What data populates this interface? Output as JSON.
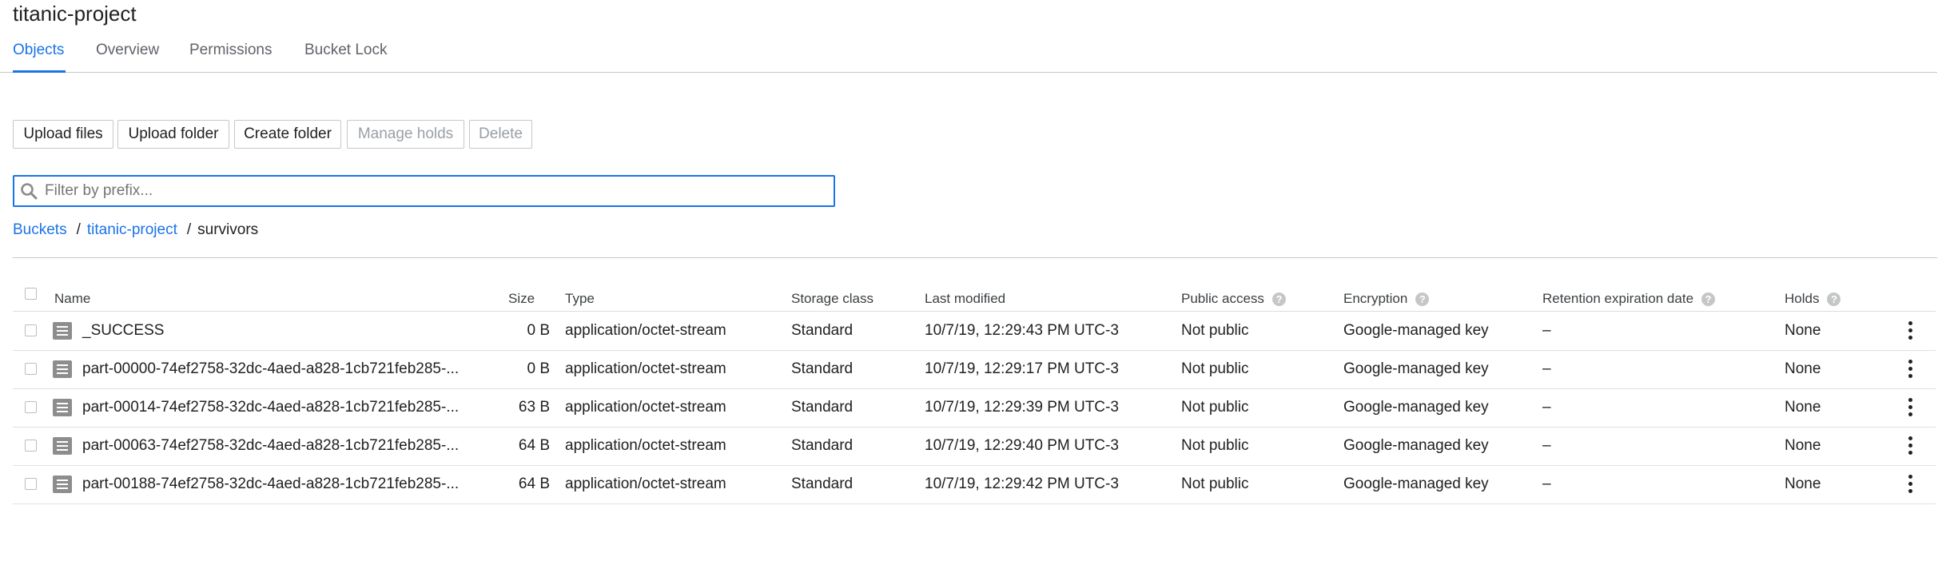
{
  "page": {
    "title": "titanic-project"
  },
  "tabs": [
    {
      "label": "Objects",
      "active": true
    },
    {
      "label": "Overview"
    },
    {
      "label": "Permissions"
    },
    {
      "label": "Bucket Lock"
    }
  ],
  "toolbar": {
    "upload_files": "Upload files",
    "upload_folder": "Upload folder",
    "create_folder": "Create folder",
    "manage_holds": "Manage holds",
    "delete": "Delete"
  },
  "filter": {
    "placeholder": "Filter by prefix...",
    "value": "",
    "icon": "search-icon"
  },
  "breadcrumb": {
    "root": "Buckets",
    "bucket": "titanic-project",
    "current": "survivors",
    "separator": "/"
  },
  "table": {
    "columns": {
      "name": "Name",
      "size": "Size",
      "type": "Type",
      "storage_class": "Storage class",
      "last_modified": "Last modified",
      "public_access": "Public access",
      "encryption": "Encryption",
      "retention": "Retention expiration date",
      "holds": "Holds"
    },
    "help_icon": "?",
    "rows": [
      {
        "name": "_SUCCESS",
        "size": "0 B",
        "type": "application/octet-stream",
        "storage_class": "Standard",
        "last_modified": "10/7/19, 12:29:43 PM UTC-3",
        "public_access": "Not public",
        "encryption": "Google-managed key",
        "retention": "–",
        "holds": "None"
      },
      {
        "name": "part-00000-74ef2758-32dc-4aed-a828-1cb721feb285-...",
        "size": "0 B",
        "type": "application/octet-stream",
        "storage_class": "Standard",
        "last_modified": "10/7/19, 12:29:17 PM UTC-3",
        "public_access": "Not public",
        "encryption": "Google-managed key",
        "retention": "–",
        "holds": "None"
      },
      {
        "name": "part-00014-74ef2758-32dc-4aed-a828-1cb721feb285-...",
        "size": "63 B",
        "type": "application/octet-stream",
        "storage_class": "Standard",
        "last_modified": "10/7/19, 12:29:39 PM UTC-3",
        "public_access": "Not public",
        "encryption": "Google-managed key",
        "retention": "–",
        "holds": "None"
      },
      {
        "name": "part-00063-74ef2758-32dc-4aed-a828-1cb721feb285-...",
        "size": "64 B",
        "type": "application/octet-stream",
        "storage_class": "Standard",
        "last_modified": "10/7/19, 12:29:40 PM UTC-3",
        "public_access": "Not public",
        "encryption": "Google-managed key",
        "retention": "–",
        "holds": "None"
      },
      {
        "name": "part-00188-74ef2758-32dc-4aed-a828-1cb721feb285-...",
        "size": "64 B",
        "type": "application/octet-stream",
        "storage_class": "Standard",
        "last_modified": "10/7/19, 12:29:42 PM UTC-3",
        "public_access": "Not public",
        "encryption": "Google-managed key",
        "retention": "–",
        "holds": "None"
      }
    ]
  },
  "colors": {
    "accent": "#1a73e8",
    "text": "#202124",
    "muted": "#5f6368",
    "disabled": "#9aa0a6"
  }
}
